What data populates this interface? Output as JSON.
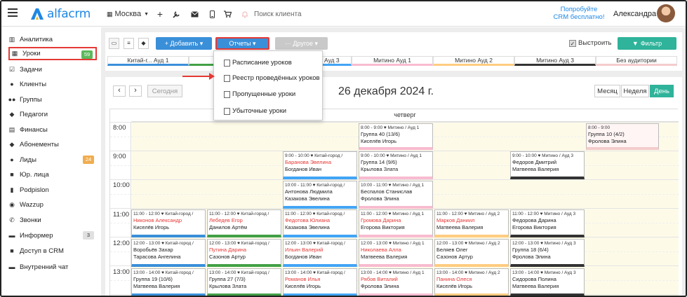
{
  "app": {
    "logo": "alfacrm",
    "branch": "Москва",
    "search_placeholder": "Поиск клиента",
    "promo_line1": "Попробуйте",
    "promo_line2": "CRM бесплатно!",
    "user": "Александра"
  },
  "sidebar": {
    "items": [
      {
        "label": "Аналитика",
        "icon": "chart-icon"
      },
      {
        "label": "Уроки",
        "icon": "calendar-icon",
        "badge": "59"
      },
      {
        "label": "Задачи",
        "icon": "tasks-icon"
      },
      {
        "label": "Клиенты",
        "icon": "user-icon"
      },
      {
        "label": "Группы",
        "icon": "users-icon"
      },
      {
        "label": "Педагоги",
        "icon": "graduation-icon"
      },
      {
        "label": "Финансы",
        "icon": "money-icon"
      },
      {
        "label": "Абонементы",
        "icon": "subscription-icon"
      },
      {
        "label": "Лиды",
        "icon": "lead-icon",
        "badge": "24"
      },
      {
        "label": "Юр. лица",
        "icon": "briefcase-icon"
      },
      {
        "label": "Podpislon",
        "icon": "document-icon"
      },
      {
        "label": "Wazzup",
        "icon": "whatsapp-icon"
      },
      {
        "label": "Звонки",
        "icon": "phone-icon"
      },
      {
        "label": "Информер",
        "icon": "inbox-icon",
        "badge": "3"
      },
      {
        "label": "Доступ в CRM",
        "icon": "lock-icon"
      },
      {
        "label": "Внутренний чат",
        "icon": "chat-icon"
      }
    ]
  },
  "toolbar": {
    "add": "+ Добавить ▾",
    "reports": "Отчеты ▾",
    "other": "··· Другое ▾",
    "align": "Выстроить",
    "filter": "Фильтр"
  },
  "rooms": [
    "Китай-г... Ауд 1",
    "",
    "",
    "Ауд 3",
    "Митино Ауд 1",
    "Митино Ауд 2",
    "Митино Ауд 3",
    "Без аудитории"
  ],
  "reports_menu": [
    "Расписание уроков",
    "Реестр проведённых уроков",
    "Пропущенные уроки",
    "Убыточные уроки"
  ],
  "calendar": {
    "today": "Сегодня",
    "title": "26 декабря 2024 г.",
    "views": [
      "Месяц",
      "Неделя",
      "День"
    ],
    "day_header": "четверг",
    "times": [
      "8:00",
      "9:00",
      "10:00",
      "11:00",
      "12:00",
      "13:00"
    ]
  },
  "events": [
    {
      "time": "8:00 - 9:00 ♥ Митино / Ауд 1",
      "who": "Группа 40 (13/6)",
      "teacher": "Киселёв Игорь",
      "red": false
    },
    {
      "time": "8:00 - 9:00",
      "who": "Группа 10 (4/2)",
      "teacher": "Фролова Элина",
      "red": false
    },
    {
      "time": "9:00 - 10:00 ♥ Китай-город / ",
      "who": "Баранова Эвелина",
      "teacher": "Богданов Иван",
      "red": true
    },
    {
      "time": "9:00 - 10:00 ♥ Митино / Ауд 1",
      "who": "Группа 14 (9/6)",
      "teacher": "Крылова Злата",
      "red": false
    },
    {
      "time": "9:00 - 10:00 ♥ Митино / Ауд 3",
      "who": "Федоров Дмитрий",
      "teacher": "Матвеева Валерия",
      "red": false
    },
    {
      "time": "10:00 - 11:00 ♥ Китай-город / ",
      "who": "Антонова Людмила",
      "teacher": "Казакова Эвелина",
      "red": false
    },
    {
      "time": "10:00 - 11:00 ♥ Митино / Ауд 1",
      "who": "Беспалов Станислав",
      "teacher": "Фролова Элина",
      "red": false
    },
    {
      "time": "11:00 - 12:00 ♥ Китай-город / ",
      "who": "Никонов Александр",
      "teacher": "Киселёв Игорь",
      "red": true
    },
    {
      "time": "11:00 - 12:00 ♥ Китай-город / ",
      "who": "Лебедев Егор",
      "teacher": "Данилов Артём",
      "red": true
    },
    {
      "time": "11:00 - 12:00 ♥ Китай-город / ",
      "who": "Федотова Юлиана",
      "teacher": "Казакова Эвелина",
      "red": true
    },
    {
      "time": "11:00 - 12:00 ♥ Митино / Ауд 1",
      "who": "Громова Дарина",
      "teacher": "Егорова Виктория",
      "red": true
    },
    {
      "time": "11:00 - 12:00 ♥ Митино / Ауд 2",
      "who": "Марков Даниил",
      "teacher": "Матвеева Валерия",
      "red": true
    },
    {
      "time": "11:00 - 12:00 ♥ Митино / Ауд 3",
      "who": "Федорова Дарина",
      "teacher": "Егорова Виктория",
      "red": false
    },
    {
      "time": "12:00 - 13:00 ♥ Китай-город / ",
      "who": "Воробьёв Захар",
      "teacher": "Тарасова Ангелина",
      "red": false
    },
    {
      "time": "12:00 - 13:00 ♥ Китай-город / ",
      "who": "Путина Дарина",
      "teacher": "Сазонов Артур",
      "red": true
    },
    {
      "time": "12:00 - 13:00 ♥ Китай-город / ",
      "who": "Ильин Валерий",
      "teacher": "Богданов Иван",
      "red": true
    },
    {
      "time": "12:00 - 13:00 ♥ Митино / Ауд 1",
      "who": "Николаева Алла",
      "teacher": "Матвеева Валерия",
      "red": true
    },
    {
      "time": "12:00 - 13:00 ♥ Митино / Ауд 2",
      "who": "Беляев Олег",
      "teacher": "Сазонов Артур",
      "red": false
    },
    {
      "time": "12:00 - 13:00 ♥ Митино / Ауд 3",
      "who": "Группа 18 (6/4)",
      "teacher": "Фролова Элина",
      "red": false
    },
    {
      "time": "13:00 - 14:00 ♥ Китай-город / ",
      "who": "Группа 19 (10/6)",
      "teacher": "Матвеева Валерия",
      "red": false
    },
    {
      "time": "13:00 - 14:00 ♥ Китай-город / ",
      "who": "Группа 27 (7/3)",
      "teacher": "Крылова Злата",
      "red": false
    },
    {
      "time": "13:00 - 14:00 ♥ Китай-город / ",
      "who": "Романов Илья",
      "teacher": "Киселёв Игорь",
      "red": true
    },
    {
      "time": "13:00 - 14:00 ♥ Митино / Ауд 1",
      "who": "Рябов Виталий",
      "teacher": "Фролова Элина",
      "red": true
    },
    {
      "time": "13:00 - 14:00 ♥ Митино / Ауд 2",
      "who": "Панина Олеся",
      "teacher": "Киселёв Игорь",
      "red": true
    },
    {
      "time": "13:00 - 14:00 ♥ Митино / Ауд 3",
      "who": "Сидорова Полина",
      "teacher": "Матвеева Валерия",
      "red": false
    }
  ]
}
